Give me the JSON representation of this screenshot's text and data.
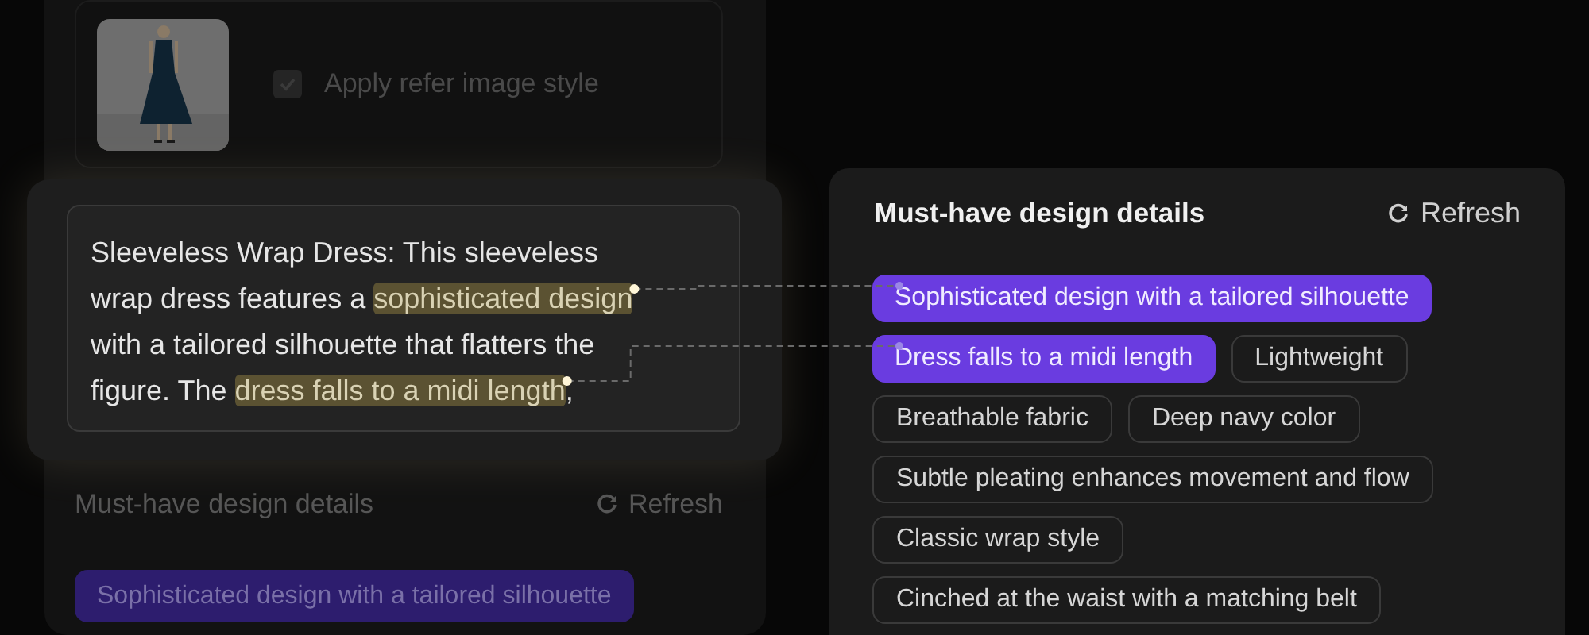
{
  "reference": {
    "apply_style": {
      "label": "Apply refer image style",
      "checked": true
    }
  },
  "description": {
    "segments": [
      {
        "text": "Sleeveless Wrap Dress: This sleeveless wrap dress features a ",
        "highlighted": false
      },
      {
        "text": "sophisticated design",
        "highlighted": true
      },
      {
        "text": " with a tailored silhouette that flatters the figure. The ",
        "highlighted": false
      },
      {
        "text": "dress falls to a midi length",
        "highlighted": true
      },
      {
        "text": ",",
        "highlighted": false
      }
    ]
  },
  "background_details": {
    "title": "Must-have design details",
    "refresh": "Refresh",
    "tags": [
      {
        "label": "Sophisticated design with a tailored silhouette",
        "selected": true
      }
    ]
  },
  "details_panel": {
    "title": "Must-have design details",
    "refresh": "Refresh",
    "tags": [
      {
        "label": "Sophisticated design with a tailored silhouette",
        "selected": true
      },
      {
        "label": "Dress falls to a midi length",
        "selected": true
      },
      {
        "label": "Lightweight",
        "selected": false
      },
      {
        "label": "Breathable fabric",
        "selected": false
      },
      {
        "label": "Deep navy color",
        "selected": false
      },
      {
        "label": "Subtle pleating enhances movement and flow",
        "selected": false
      },
      {
        "label": "Classic wrap style",
        "selected": false
      },
      {
        "label": "Cinched at the waist with a matching belt",
        "selected": false
      }
    ]
  }
}
